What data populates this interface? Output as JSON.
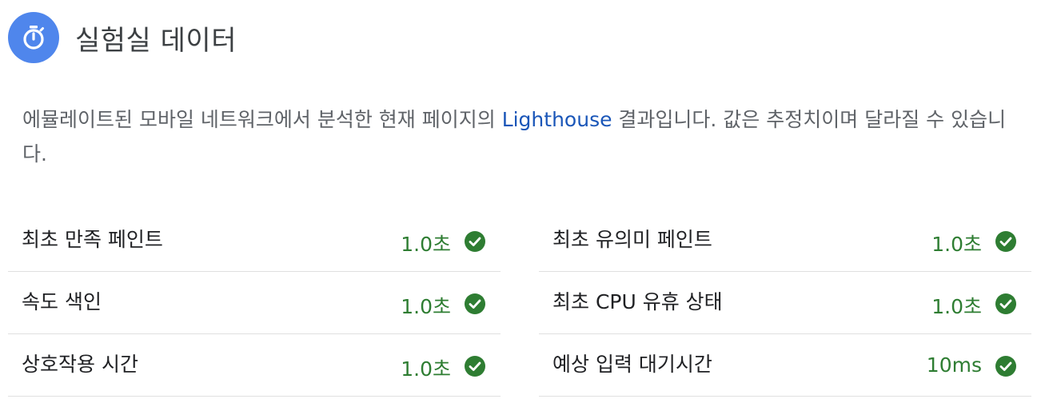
{
  "header": {
    "icon": "stopwatch-icon",
    "title": "실험실 데이터"
  },
  "description": {
    "before_link": "에뮬레이트된 모바일 네트워크에서 분석한 현재 페이지의 ",
    "link_text": "Lighthouse",
    "after_link": " 결과입니다. 값은 추정치이며 달라질 수 있습니다."
  },
  "metrics": {
    "left": [
      {
        "label": "최초 만족 페인트",
        "value": "1.0초",
        "status": "pass"
      },
      {
        "label": "속도 색인",
        "value": "1.0초",
        "status": "pass"
      },
      {
        "label": "상호작용 시간",
        "value": "1.0초",
        "status": "pass"
      }
    ],
    "right": [
      {
        "label": "최초 유의미 페인트",
        "value": "1.0초",
        "status": "pass"
      },
      {
        "label": "최초 CPU 유휴 상태",
        "value": "1.0초",
        "status": "pass"
      },
      {
        "label": "예상 입력 대기시간",
        "value": "10ms",
        "status": "pass"
      }
    ]
  },
  "colors": {
    "header_icon_bg": "#4f86ec",
    "pass_green": "#2e7d32",
    "link_blue": "#1a56b8"
  }
}
